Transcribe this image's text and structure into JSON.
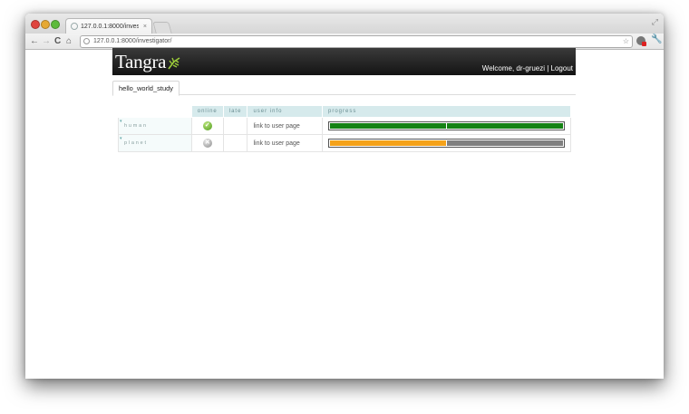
{
  "browser": {
    "tab_title": "127.0.0.1:8000/investigator/",
    "tab_close": "×",
    "url": "127.0.0.1:8000/investigator/",
    "back": "←",
    "forward": "→",
    "reload": "C",
    "home": "⌂",
    "star": "☆",
    "wrench": "🔧",
    "resize": "⤢"
  },
  "header": {
    "logo": "Tangra",
    "welcome_prefix": "Welcome, dr-gruezi",
    "separator": " | ",
    "logout": "Logout"
  },
  "tabs": [
    {
      "label": "hello_world_study"
    }
  ],
  "table": {
    "columns": [
      "online",
      "late",
      "user info",
      "progress"
    ],
    "rows": [
      {
        "name": "human",
        "marker": "▾",
        "online": true,
        "online_icon": "check-icon",
        "late": "",
        "user_link": "link to user page",
        "progress": [
          {
            "status": "complete",
            "color": "#148214"
          },
          {
            "status": "complete",
            "color": "#148214"
          }
        ]
      },
      {
        "name": "planet",
        "marker": "▾",
        "online": false,
        "online_icon": "offline-icon",
        "late": "",
        "user_link": "link to user page",
        "progress": [
          {
            "status": "in-progress",
            "color": "#f5a21a"
          },
          {
            "status": "pending",
            "color": "#808080"
          }
        ]
      }
    ]
  }
}
